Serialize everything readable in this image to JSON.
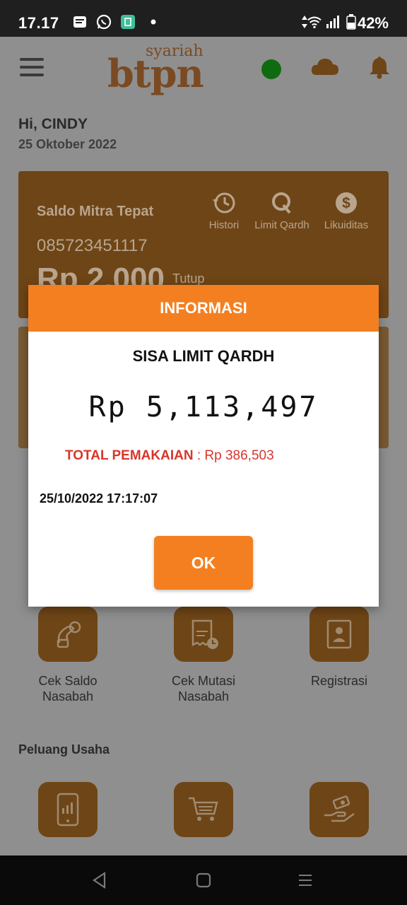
{
  "status_bar": {
    "time": "17.17",
    "battery": "42%",
    "icons": [
      "message-icon",
      "whatsapp-icon",
      "app-icon",
      "dot-icon",
      "data-arrows-icon",
      "wifi-icon",
      "signal-icon",
      "battery-icon"
    ]
  },
  "header": {
    "logo_small": "syariah",
    "logo_main": "btpn"
  },
  "greeting": {
    "name": "Hi, CINDY",
    "date": "25 Oktober 2022"
  },
  "saldo_card": {
    "label": "Saldo Mitra Tepat",
    "phone": "085723451117",
    "amount": "Rp 2.000",
    "toggle": "Tutup",
    "actions": [
      {
        "label": "Histori",
        "icon": "history-icon"
      },
      {
        "label": "Limit Qardh",
        "icon": "q-icon"
      },
      {
        "label": "Likuiditas",
        "icon": "dollar-icon"
      }
    ]
  },
  "menu": [
    {
      "label1": "Cek Saldo",
      "label2": "Nasabah",
      "icon": "check-balance-icon"
    },
    {
      "label1": "Cek Mutasi",
      "label2": "Nasabah",
      "icon": "mutation-icon"
    },
    {
      "label1": "Registrasi",
      "label2": "",
      "icon": "registration-icon"
    }
  ],
  "section": {
    "title": "Peluang Usaha"
  },
  "dialog": {
    "title": "INFORMASI",
    "subtitle": "SISA LIMIT QARDH",
    "amount": "Rp 5,113,497",
    "usage_label": "TOTAL PEMAKAIAN",
    "usage_sep": " : ",
    "usage_value": "Rp 386,503",
    "timestamp": "25/10/2022 17:17:07",
    "ok_label": "OK"
  },
  "colors": {
    "accent": "#f47f20",
    "usage_red": "#d8352a",
    "online_green": "#0f6b0f"
  }
}
